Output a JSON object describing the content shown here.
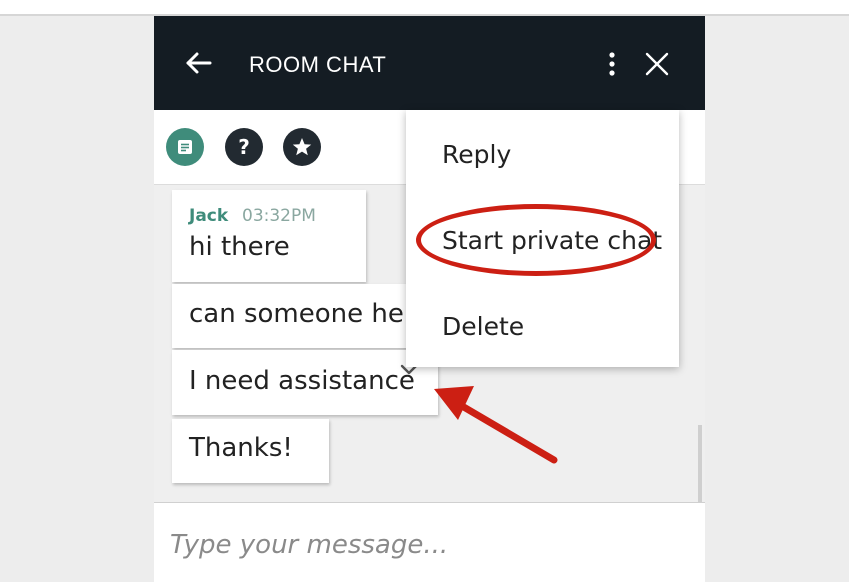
{
  "header": {
    "title": "ROOM CHAT",
    "back_icon": "arrow-left-icon",
    "more_icon": "more-vertical-icon",
    "close_icon": "close-icon",
    "background": "#141c23"
  },
  "toolbar": {
    "buttons": [
      {
        "name": "chat",
        "icon": "message-icon",
        "color": "#3f8c7b"
      },
      {
        "name": "help",
        "icon": "question-icon",
        "glyph": "?",
        "color": "#222a31"
      },
      {
        "name": "favorites",
        "icon": "star-icon",
        "glyph": "★",
        "color": "#222a31"
      }
    ]
  },
  "messages": [
    {
      "sender": "Jack",
      "time": "03:32PM",
      "text": "hi there"
    },
    {
      "text": "can someone help"
    },
    {
      "text": "I need assistance",
      "menu_icon": "chevron-down-icon"
    },
    {
      "text": "Thanks!"
    }
  ],
  "input": {
    "placeholder": "Type your message...",
    "value": ""
  },
  "context_menu": {
    "items": [
      "Reply",
      "Start private chat",
      "Delete"
    ],
    "highlighted": "Start private chat"
  },
  "annotation": {
    "color": "#cc1f13",
    "arrow_icon": "annotation-arrow",
    "highlight_shape": "ellipse"
  }
}
